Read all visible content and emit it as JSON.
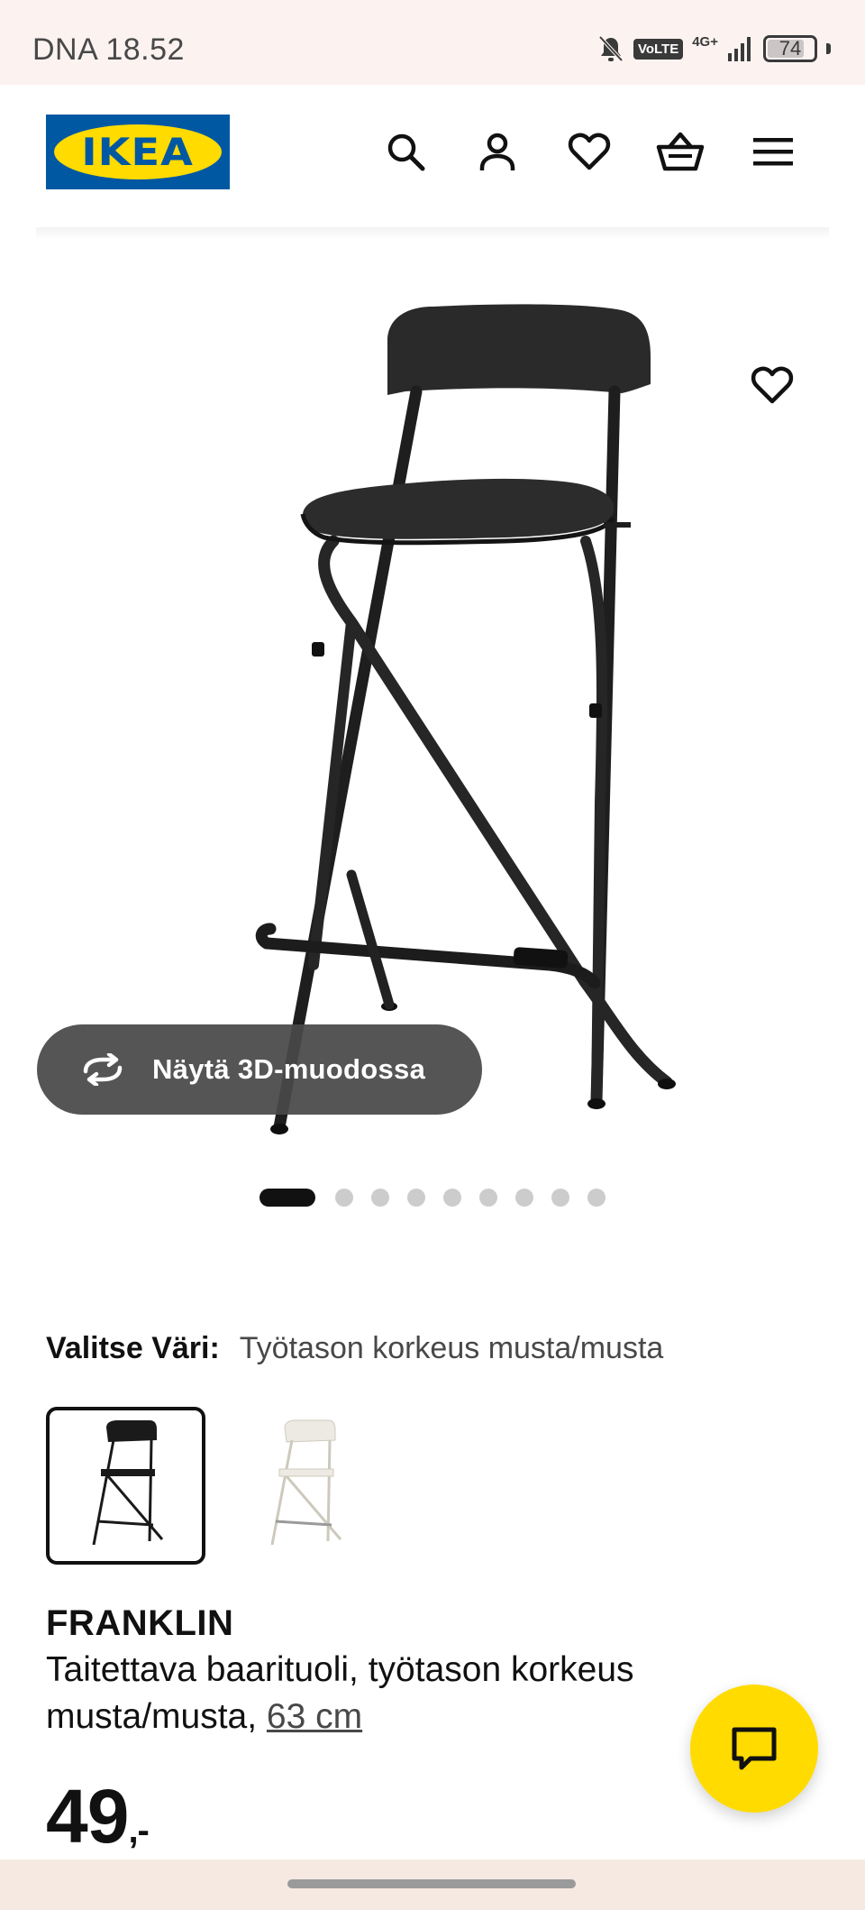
{
  "status_bar": {
    "time": "DNA 18.52",
    "icons": [
      "bell-off-icon",
      "volte-icon",
      "signal-icon",
      "battery-icon"
    ],
    "volte_label": "VoLTE",
    "network_label": "4G+",
    "battery_label": "74",
    "battery_level": 0.74
  },
  "header": {
    "logo_text": "IKEA",
    "icons": [
      "search-icon",
      "account-icon",
      "wishlist-heart-icon",
      "shopping-bag-icon",
      "menu-icon"
    ],
    "brand_colors": {
      "blue": "#0058a3",
      "yellow": "#ffdb00"
    }
  },
  "gallery": {
    "view_3d_label": "Näytä 3D-muodossa",
    "view_3d_icon": "rotate-3d-icon",
    "favorite_icon": "heart-outline-icon",
    "image_count": 9,
    "active_index": 0
  },
  "color_selector": {
    "label": "Valitse Väri:",
    "selected_value": "Työtason korkeus musta/musta",
    "swatches": [
      {
        "color": "#1a1a1a",
        "selected": true
      },
      {
        "color": "#f3f1ea",
        "selected": false
      }
    ]
  },
  "product": {
    "name": "FRANKLIN",
    "description": "Taitettava baarituoli, työtason korkeus musta/musta, ",
    "size_link": "63 cm",
    "price": "49",
    "price_suffix": ",-"
  },
  "chat": {
    "icon": "chat-bubble-icon",
    "color": "#ffdb00"
  }
}
